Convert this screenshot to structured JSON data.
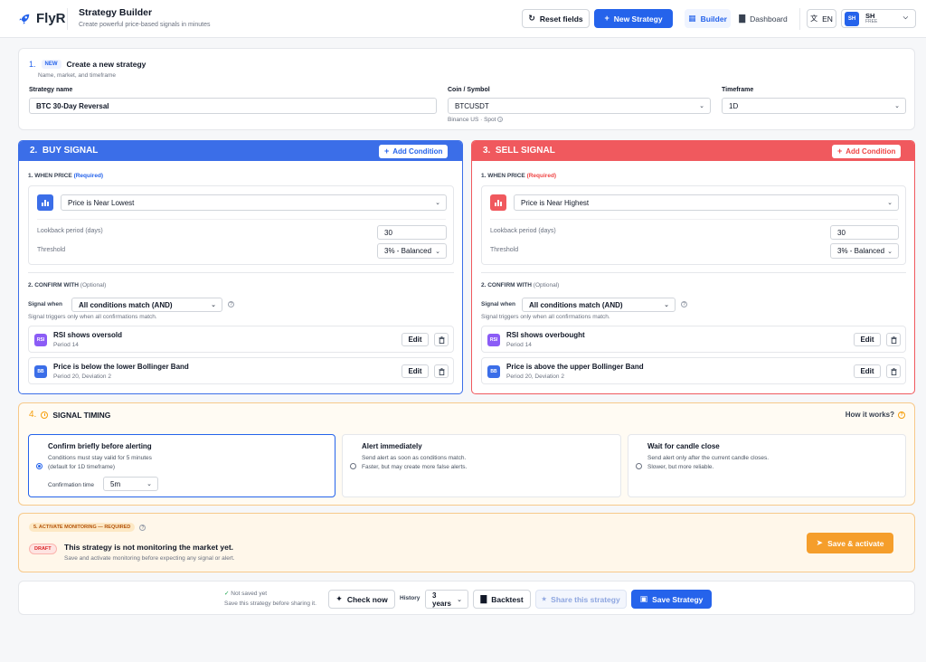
{
  "header": {
    "logo_text": "FlyR",
    "title": "Strategy Builder",
    "subtitle": "Create powerful price-based signals in minutes",
    "reset_label": "Reset fields",
    "new_strategy_label": "New Strategy",
    "builder_label": "Builder",
    "dashboard_label": "Dashboard",
    "lang_label": "EN",
    "user_initials": "SH",
    "user_name": "SH",
    "user_plan": "FREE"
  },
  "create": {
    "step": "1.",
    "badge": "NEW",
    "title": "Create a new strategy",
    "subtitle": "Name, market, and timeframe",
    "name_label": "Strategy name",
    "name_value": "BTC 30-Day Reversal",
    "coin_label": "Coin / Symbol",
    "coin_value": "BTCUSDT",
    "coin_hint": "Binance US · Spot",
    "timeframe_label": "Timeframe",
    "timeframe_value": "1D"
  },
  "buy": {
    "step": "2.",
    "title": "BUY SIGNAL",
    "add_label": "Add Condition",
    "when_label": "1. WHEN PRICE",
    "when_tag": "(Required)",
    "price_select": "Price is Near Lowest",
    "lookback_label": "Lookback period (days)",
    "lookback_value": "30",
    "threshold_label": "Threshold",
    "threshold_value": "3% - Balanced",
    "confirm_label": "2. CONFIRM WITH",
    "confirm_tag": "(Optional)",
    "signal_when_label": "Signal when",
    "signal_when_value": "All conditions match (AND)",
    "signal_hint": "Signal triggers only when all confirmations match.",
    "conditions": [
      {
        "badge": "RSI",
        "title": "RSI shows oversold",
        "sub": "Period 14",
        "edit": "Edit"
      },
      {
        "badge": "BB",
        "title": "Price is below the lower Bollinger Band",
        "sub": "Period 20, Deviation 2",
        "edit": "Edit"
      }
    ]
  },
  "sell": {
    "step": "3.",
    "title": "SELL SIGNAL",
    "add_label": "Add Condition",
    "when_label": "1. WHEN PRICE",
    "when_tag": "(Required)",
    "price_select": "Price is Near Highest",
    "lookback_label": "Lookback period (days)",
    "lookback_value": "30",
    "threshold_label": "Threshold",
    "threshold_value": "3% - Balanced",
    "confirm_label": "2. CONFIRM WITH",
    "confirm_tag": "(Optional)",
    "signal_when_label": "Signal when",
    "signal_when_value": "All conditions match (AND)",
    "signal_hint": "Signal triggers only when all confirmations match.",
    "conditions": [
      {
        "badge": "RSI",
        "title": "RSI shows overbought",
        "sub": "Period 14",
        "edit": "Edit"
      },
      {
        "badge": "BB",
        "title": "Price is above the upper Bollinger Band",
        "sub": "Period 20, Deviation 2",
        "edit": "Edit"
      }
    ]
  },
  "timing": {
    "step": "4.",
    "title": "SIGNAL TIMING",
    "how_label": "How it works?",
    "options": [
      {
        "title": "Confirm briefly before alerting",
        "desc1": "Conditions must stay valid for 5 minutes",
        "desc2": "(default for 1D timeframe)",
        "selected": true
      },
      {
        "title": "Alert immediately",
        "desc1": "Send alert as soon as conditions match.",
        "desc2": "Faster, but may create more false alerts.",
        "selected": false
      },
      {
        "title": "Wait for candle close",
        "desc1": "Send alert only after the current candle closes.",
        "desc2": "Slower, but more reliable.",
        "selected": false
      }
    ],
    "confirmation_label": "Confirmation time",
    "confirmation_value": "5m"
  },
  "activate": {
    "label": "5. ACTIVATE MONITORING — REQUIRED",
    "draft_badge": "DRAFT",
    "title": "This strategy is not monitoring the market yet.",
    "subtitle": "Save and activate monitoring before expecting any signal or alert.",
    "button": "Save & activate"
  },
  "footer": {
    "not_saved": "Not saved yet",
    "not_saved_hint": "Save this strategy before sharing it.",
    "check_label": "Check now",
    "history_label": "History",
    "history_value": "3 years",
    "backtest_label": "Backtest",
    "share_label": "Share this strategy",
    "save_label": "Save Strategy"
  },
  "colors": {
    "primary": "#2563eb",
    "buy": "#3b6ee8",
    "sell": "#f0595e",
    "timing_border": "#f7c98a",
    "activate_button": "#f59e2b"
  }
}
